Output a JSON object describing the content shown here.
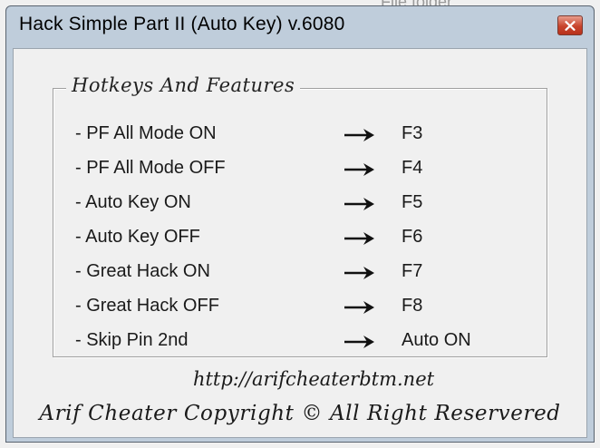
{
  "background": {
    "partial_text": "File folder"
  },
  "window": {
    "title": "Hack Simple Part II (Auto Key) v.6080",
    "close_icon": "close-icon",
    "colors": {
      "frame": "#bfcddb",
      "close_button": "#c8442c",
      "client": "#f0f0f0"
    }
  },
  "group": {
    "caption": "Hotkeys And Features",
    "rows": [
      {
        "label": "- PF All Mode ON",
        "key": "F3"
      },
      {
        "label": "- PF All Mode OFF",
        "key": "F4"
      },
      {
        "label": "- Auto Key ON",
        "key": "F5"
      },
      {
        "label": "- Auto Key OFF",
        "key": "F6"
      },
      {
        "label": "- Great Hack ON",
        "key": "F7"
      },
      {
        "label": "- Great Hack OFF",
        "key": "F8"
      },
      {
        "label": "- Skip Pin 2nd",
        "key": "Auto ON"
      }
    ],
    "arrow_icon": "arrow-right-icon"
  },
  "footer": {
    "url": "http://arifcheaterbtm.net",
    "copyright": "Arif Cheater Copyright © All Right Reservered"
  }
}
